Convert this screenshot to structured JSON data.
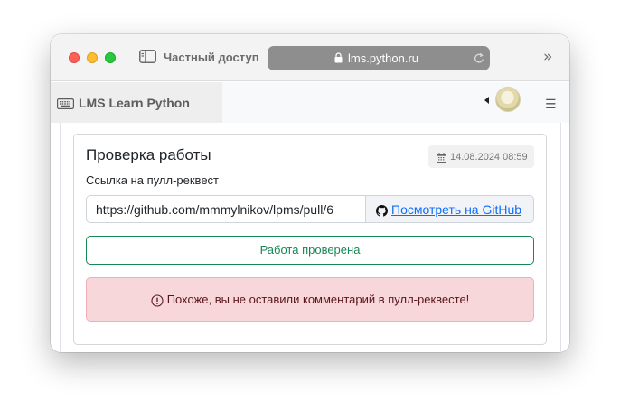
{
  "browser": {
    "private_label": "Частный доступ",
    "url": "lms.python.ru"
  },
  "navbar": {
    "brand": "LMS Learn Python"
  },
  "card": {
    "title": "Проверка работы",
    "date": "14.08.2024 08:59",
    "pr_label": "Ссылка на пулл-реквест",
    "pr_url": "https://github.com/mmmylnikov/lpms/pull/6",
    "github_link": "Посмотреть на GitHub",
    "status_button": "Работа проверена",
    "alert_text": "Похоже, вы не оставили комментарий в пулл-реквесте!"
  },
  "icons": {
    "sidebar": "sidebar-toggle-icon",
    "lock": "lock-icon",
    "reload": "reload-icon",
    "more": "chevron-double-right-icon",
    "keyboard": "keyboard-icon",
    "menu": "hamburger-menu-icon",
    "calendar": "calendar-icon",
    "github": "github-icon",
    "warning": "exclamation-circle-icon"
  },
  "colors": {
    "success": "#198754",
    "danger_bg": "#f8d7da",
    "danger_text": "#58151c",
    "link": "#0d6efd"
  }
}
